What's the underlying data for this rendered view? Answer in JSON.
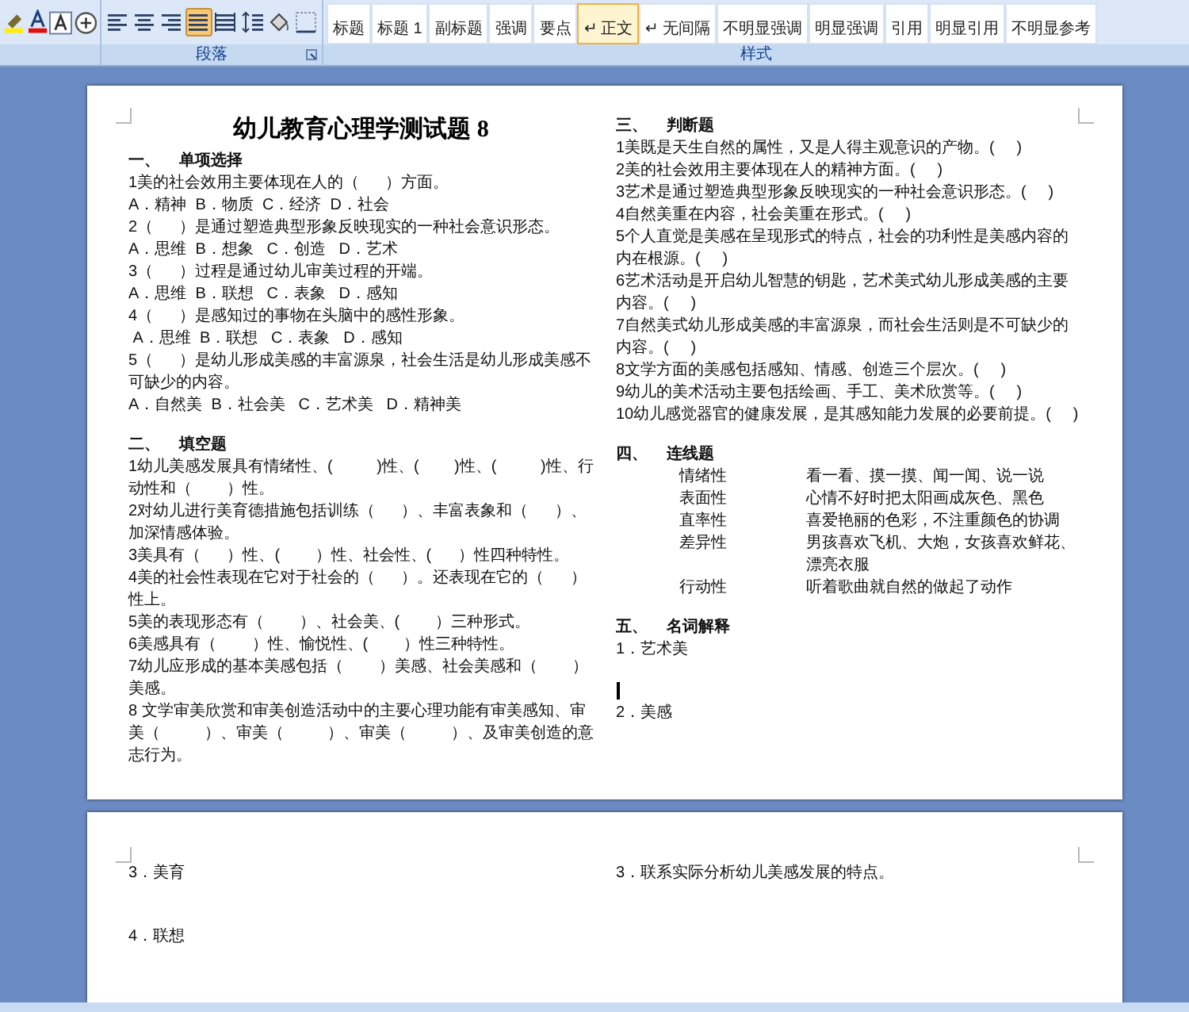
{
  "ribbon": {
    "font_group": {
      "tools": [
        {
          "kind": "highlight"
        },
        {
          "kind": "font_color"
        },
        {
          "kind": "char_border"
        },
        {
          "kind": "enclose"
        }
      ]
    },
    "paragraph_group": {
      "label": "段落",
      "tools": [
        {
          "kind": "align_left",
          "selected": false
        },
        {
          "kind": "align_center",
          "selected": false
        },
        {
          "kind": "align_right",
          "selected": false
        },
        {
          "kind": "justify",
          "selected": true
        },
        {
          "kind": "distribute",
          "selected": false
        },
        {
          "kind": "line_spacing",
          "selected": false
        },
        {
          "kind": "shading",
          "selected": false
        },
        {
          "kind": "borders",
          "selected": false
        }
      ]
    },
    "styles_group": {
      "label": "样式",
      "styles": [
        {
          "label": "标题",
          "selected": false
        },
        {
          "label": "标题 1",
          "selected": false
        },
        {
          "label": "副标题",
          "selected": false
        },
        {
          "label": "强调",
          "selected": false
        },
        {
          "label": "要点",
          "selected": false
        },
        {
          "label": "↵ 正文",
          "selected": true
        },
        {
          "label": "↵ 无间隔",
          "selected": false
        },
        {
          "label": "不明显强调",
          "selected": false
        },
        {
          "label": "明显强调",
          "selected": false
        },
        {
          "label": "引用",
          "selected": false
        },
        {
          "label": "明显引用",
          "selected": false
        },
        {
          "label": "不明显参考",
          "selected": false
        }
      ]
    }
  },
  "page_1": {
    "title": "幼儿教育心理学测试题 8",
    "left_sections": [
      {
        "number": "一、",
        "heading": "单项选择",
        "lines": [
          {
            "kind": "text",
            "text": "1美的社会效用主要体现在人的（      ）方面。"
          },
          {
            "kind": "text",
            "text": "A．精神  B．物质  C．经济  D．社会"
          },
          {
            "kind": "text",
            "text": "2（      ）是通过塑造典型形象反映现实的一种社会意识形态。"
          },
          {
            "kind": "text",
            "text": "A．思维  B．想象   C．创造   D．艺术"
          },
          {
            "kind": "text",
            "text": "3（      ）过程是通过幼儿审美过程的开端。"
          },
          {
            "kind": "text",
            "text": "A．思维  B．联想   C．表象   D．感知"
          },
          {
            "kind": "text",
            "text": "4（      ）是感知过的事物在头脑中的感性形象。"
          },
          {
            "kind": "text",
            "text": " A．思维  B．联想   C．表象   D．感知"
          },
          {
            "kind": "text",
            "text": "5（      ）是幼儿形成美感的丰富源泉，社会生活是幼儿形成美感不可缺少的内容。"
          },
          {
            "kind": "text",
            "text": "A．自然美  B．社会美   C．艺术美   D．精神美"
          }
        ]
      },
      {
        "number": "二、",
        "heading": "填空题",
        "lines": [
          {
            "kind": "text",
            "text": "1幼儿美感发展具有情绪性、(          )性、(        )性、(          )性、行动性和（        ）性。"
          },
          {
            "kind": "text",
            "text": "2对幼儿进行美育德措施包括训练（      ）、丰富表象和（      ）、加深情感体验。"
          },
          {
            "kind": "text",
            "text": "3美具有（      ）性、(        ）性、社会性、(      ）性四种特性。"
          },
          {
            "kind": "text",
            "text": "4美的社会性表现在它对于社会的（      ）。还表现在它的（      ）性上。"
          },
          {
            "kind": "text",
            "text": "5美的表现形态有（        ）、社会美、(        ）三种形式。"
          },
          {
            "kind": "text",
            "text": "6美感具有（        ）性、愉悦性、(        ）性三种特性。"
          },
          {
            "kind": "text",
            "text": "7幼儿应形成的基本美感包括（        ）美感、社会美感和（        ）美感。"
          },
          {
            "kind": "text",
            "text": "8 文学审美欣赏和审美创造活动中的主要心理功能有审美感知、审美（          ）、审美（          ）、审美（          ）、及审美创造的意志行为。"
          }
        ]
      }
    ],
    "right_sections": [
      {
        "number": "三、",
        "heading": "判断题",
        "lines": [
          {
            "kind": "text",
            "text": "1美既是天生自然的属性，又是人得主观意识的产物。(     )"
          },
          {
            "kind": "text",
            "text": "2美的社会效用主要体现在人的精神方面。(     )"
          },
          {
            "kind": "text",
            "text": "3艺术是通过塑造典型形象反映现实的一种社会意识形态。(     )"
          },
          {
            "kind": "text",
            "text": "4自然美重在内容，社会美重在形式。(     )"
          },
          {
            "kind": "text",
            "text": "5个人直觉是美感在呈现形式的特点，社会的功利性是美感内容的内在根源。(     )"
          },
          {
            "kind": "text",
            "text": "6艺术活动是开启幼儿智慧的钥匙，艺术美式幼儿形成美感的主要内容。(     )"
          },
          {
            "kind": "text",
            "text": "7自然美式幼儿形成美感的丰富源泉，而社会生活则是不可缺少的内容。(     )"
          },
          {
            "kind": "text",
            "text": "8文学方面的美感包括感知、情感、创造三个层次。(     )"
          },
          {
            "kind": "text",
            "text": "9幼儿的美术活动主要包括绘画、手工、美术欣赏等。(     )"
          },
          {
            "kind": "text",
            "text": "10幼儿感觉器官的健康发展，是其感知能力发展的必要前提。(     )"
          }
        ]
      },
      {
        "number": "四、",
        "heading": "连线题",
        "lines": [
          {
            "kind": "match",
            "left": "情绪性",
            "right": "看一看、摸一摸、闻一闻、说一说"
          },
          {
            "kind": "match",
            "left": "表面性",
            "right": "心情不好时把太阳画成灰色、黑色"
          },
          {
            "kind": "match",
            "left": "直率性",
            "right": "喜爱艳丽的色彩，不注重颜色的协调"
          },
          {
            "kind": "match",
            "left": "差异性",
            "right": "男孩喜欢飞机、大炮，女孩喜欢鲜花、漂亮衣服"
          },
          {
            "kind": "match",
            "left": "行动性",
            "right": "听着歌曲就自然的做起了动作"
          }
        ]
      },
      {
        "number": "五、",
        "heading": "名词解释",
        "lines": [
          {
            "kind": "text",
            "text": "1．艺术美"
          },
          {
            "kind": "answer_space",
            "cursor": true
          },
          {
            "kind": "text",
            "text": "2．美感"
          }
        ]
      }
    ]
  },
  "page_2": {
    "left_lines": [
      {
        "kind": "text",
        "text": "3．美育"
      },
      {
        "kind": "answer_space"
      },
      {
        "kind": "text",
        "text": "4．联想"
      }
    ],
    "right_lines": [
      {
        "kind": "text",
        "text": "3．联系实际分析幼儿美感发展的特点。"
      }
    ]
  }
}
